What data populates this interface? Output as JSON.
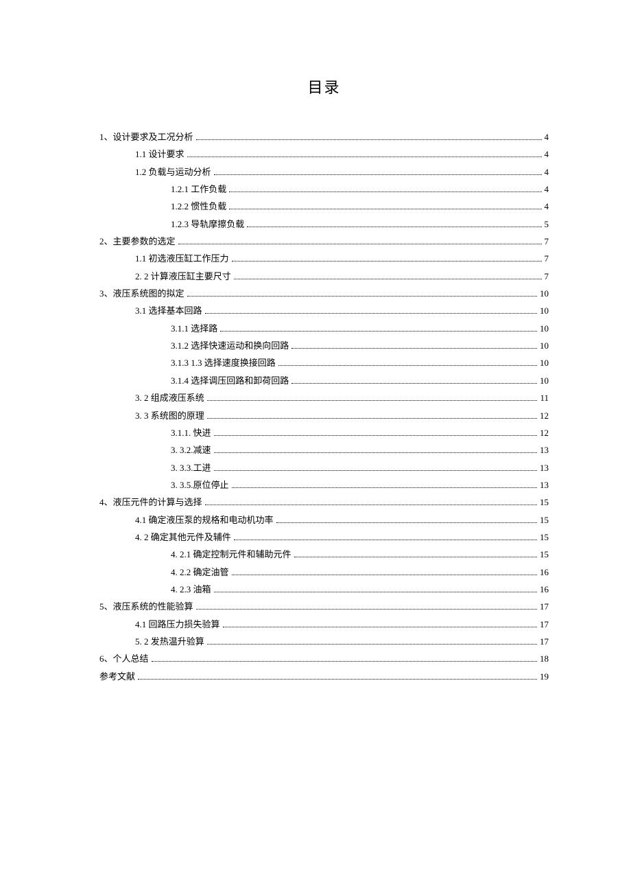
{
  "title": "目录",
  "entries": [
    {
      "indent": 0,
      "text": "1、设计要求及工况分析",
      "page": "4"
    },
    {
      "indent": 1,
      "text": "1.1  设计要求",
      "page": "4"
    },
    {
      "indent": 1,
      "text": "1.2  负载与运动分析",
      "page": "4"
    },
    {
      "indent": 2,
      "text": "1.2.1 工作负载",
      "page": "4"
    },
    {
      "indent": 2,
      "text": "1.2.2 惯性负载",
      "page": "4"
    },
    {
      "indent": 2,
      "text": "1.2.3 导轨摩擦负载",
      "page": "5"
    },
    {
      "indent": 0,
      "text": "2、主要参数的选定",
      "page": "7"
    },
    {
      "indent": 1,
      "text": "1.1  初选液压缸工作压力",
      "page": "7"
    },
    {
      "indent": 1,
      "text": "2.  2 计算液压缸主要尺寸",
      "page": "7"
    },
    {
      "indent": 0,
      "text": "3、液压系统图的拟定",
      "page": "10"
    },
    {
      "indent": 1,
      "text": "3.1 选择基本回路",
      "page": "10"
    },
    {
      "indent": 2,
      "text": "3.1.1  选择路",
      "page": "10"
    },
    {
      "indent": 2,
      "text": "3.1.2  选择快速运动和换向回路",
      "page": "10"
    },
    {
      "indent": 2,
      "text": "3.1.3 1.3 选择速度换接回路",
      "page": "10"
    },
    {
      "indent": 2,
      "text": "3.1.4  选择调压回路和卸荷回路",
      "page": "10"
    },
    {
      "indent": 1,
      "text": "3.  2 组成液压系统",
      "page": "11"
    },
    {
      "indent": 1,
      "text": "3.  3 系统图的原理",
      "page": "12"
    },
    {
      "indent": 2,
      "text": "3.1.1.  快进",
      "page": "12"
    },
    {
      "indent": 2,
      "text": "3.  3.2.减速",
      "page": "13"
    },
    {
      "indent": 2,
      "text": "3.  3.3.工进",
      "page": "13"
    },
    {
      "indent": 2,
      "text": "3.  3.5.原位停止",
      "page": "13"
    },
    {
      "indent": 0,
      "text": "4、液压元件的计算与选择",
      "page": "15"
    },
    {
      "indent": 1,
      "text": "4.1 确定液压泵的规格和电动机功率",
      "page": "15"
    },
    {
      "indent": 1,
      "text": "4.  2 确定其他元件及辅件",
      "page": "15"
    },
    {
      "indent": 2,
      "text": "4.  2.1 确定控制元件和辅助元件",
      "page": "15"
    },
    {
      "indent": 2,
      "text": "4.  2.2 确定油管",
      "page": "16"
    },
    {
      "indent": 2,
      "text": "4.  2.3 油箱",
      "page": "16"
    },
    {
      "indent": 0,
      "text": "5、液压系统的性能验算",
      "page": "17"
    },
    {
      "indent": 1,
      "text": "4.1  回路压力损失验算",
      "page": "17"
    },
    {
      "indent": 1,
      "text": "5.  2 发热温升验算",
      "page": "17"
    },
    {
      "indent": 0,
      "text": "6、个人总结",
      "page": "18"
    },
    {
      "indent": 0,
      "text": "参考文献",
      "page": "19"
    }
  ]
}
